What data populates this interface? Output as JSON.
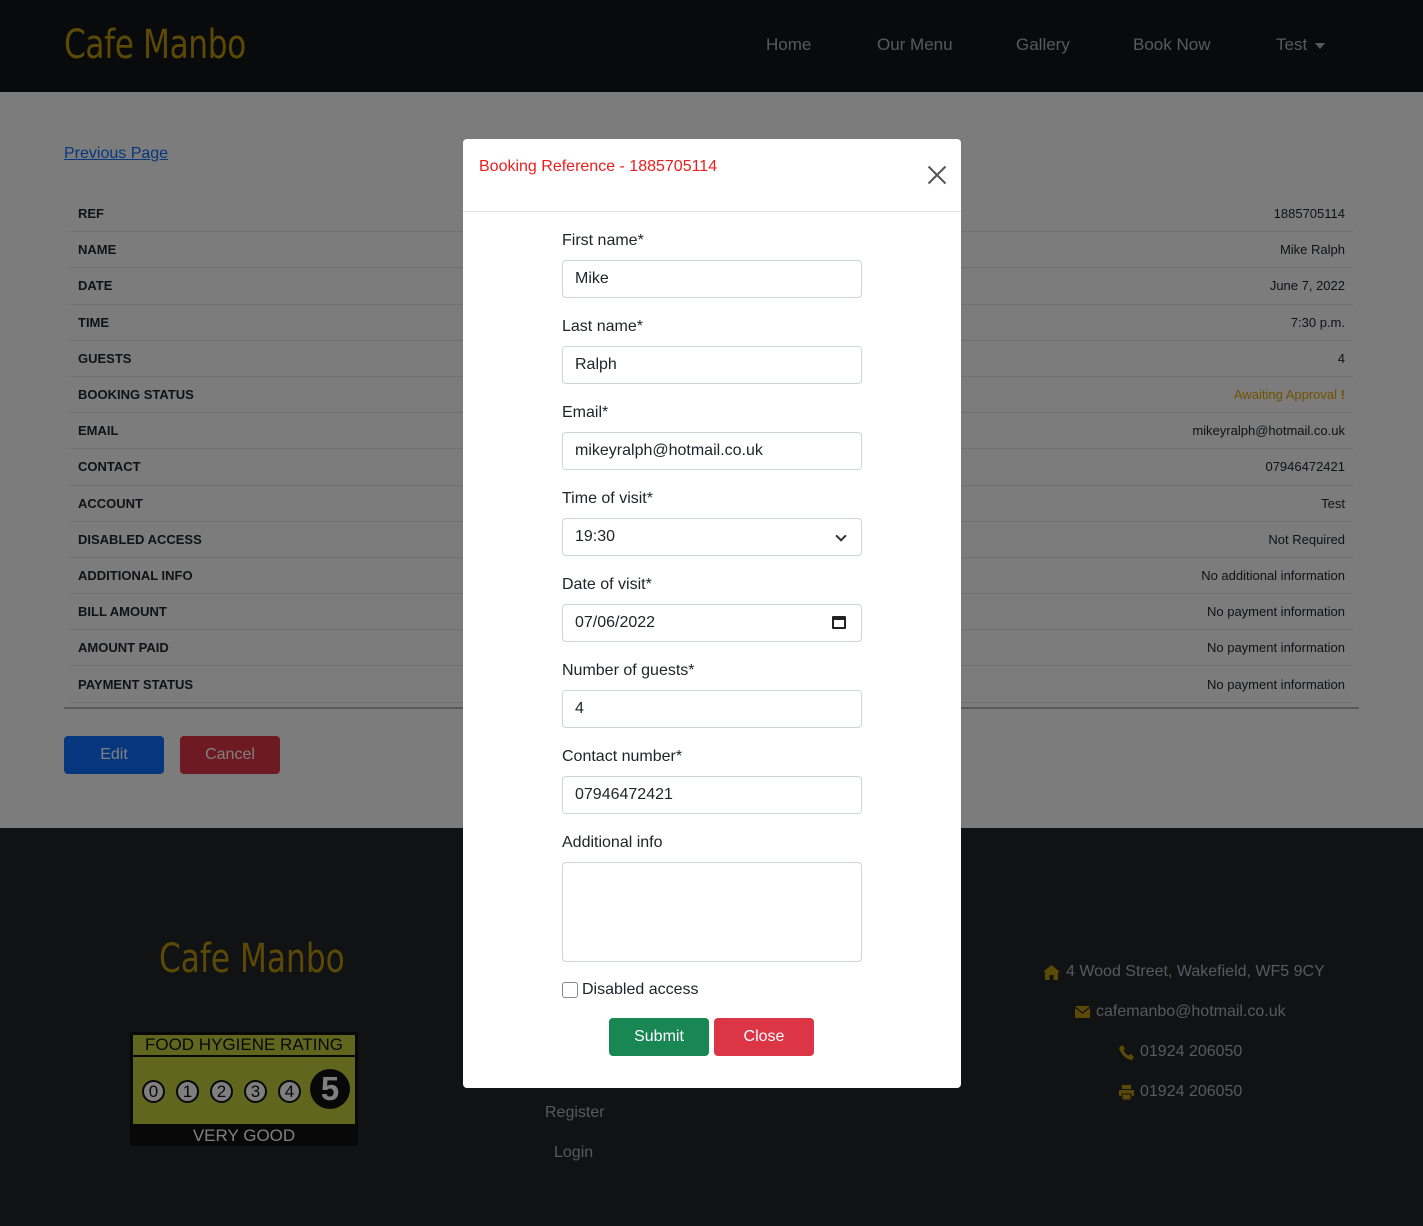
{
  "navbar": {
    "brand": "Cafe Manbo",
    "links": [
      "Home",
      "Our Menu",
      "Gallery",
      "Book Now"
    ],
    "user_dropdown": "Test"
  },
  "page": {
    "previous_link": "Previous Page",
    "details": [
      {
        "key": "REF",
        "value": "1885705114"
      },
      {
        "key": "NAME",
        "value": "Mike Ralph"
      },
      {
        "key": "DATE",
        "value": "June 7, 2022"
      },
      {
        "key": "TIME",
        "value": "7:30 p.m."
      },
      {
        "key": "GUESTS",
        "value": "4"
      },
      {
        "key": "BOOKING STATUS",
        "value": "Awaiting Approval"
      },
      {
        "key": "EMAIL",
        "value": "mikeyralph@hotmail.co.uk"
      },
      {
        "key": "CONTACT",
        "value": "07946472421"
      },
      {
        "key": "ACCOUNT",
        "value": "Test"
      },
      {
        "key": "DISABLED ACCESS",
        "value": "Not Required"
      },
      {
        "key": "ADDITIONAL INFO",
        "value": "No additional information"
      },
      {
        "key": "BILL AMOUNT",
        "value": "No payment information"
      },
      {
        "key": "AMOUNT PAID",
        "value": "No payment information"
      },
      {
        "key": "PAYMENT STATUS",
        "value": "No payment information"
      }
    ],
    "status_mark": "!",
    "edit_label": "Edit",
    "cancel_label": "Cancel"
  },
  "footer": {
    "brand": "Cafe Manbo",
    "rating": {
      "title": "FOOD HYGIENE RATING",
      "scale": [
        "0",
        "1",
        "2",
        "3",
        "4"
      ],
      "score": "5",
      "caption": "VERY GOOD"
    },
    "links": [
      "Register",
      "Login"
    ],
    "contact": {
      "address": "4 Wood Street, Wakefield, WF5 9CY",
      "email": "cafemanbo@hotmail.co.uk",
      "phone": "01924 206050",
      "fax": "01924 206050"
    },
    "icons": [
      "home-icon",
      "envelope-icon",
      "phone-icon",
      "print-icon"
    ],
    "accent_color": "#b8920c"
  },
  "modal": {
    "title": "Booking Reference - 1885705114",
    "fields": {
      "first_name": {
        "label": "First name*",
        "value": "Mike"
      },
      "last_name": {
        "label": "Last name*",
        "value": "Ralph"
      },
      "email": {
        "label": "Email*",
        "value": "mikeyralph@hotmail.co.uk"
      },
      "time": {
        "label": "Time of visit*",
        "value": "19:30"
      },
      "date": {
        "label": "Date of visit*",
        "value": "07/06/2022"
      },
      "guests": {
        "label": "Number of guests*",
        "value": "4"
      },
      "contact": {
        "label": "Contact number*",
        "value": "07946472421"
      },
      "info": {
        "label": "Additional info",
        "value": ""
      }
    },
    "disabled_access_label": "Disabled access",
    "submit_label": "Submit",
    "close_label": "Close"
  }
}
